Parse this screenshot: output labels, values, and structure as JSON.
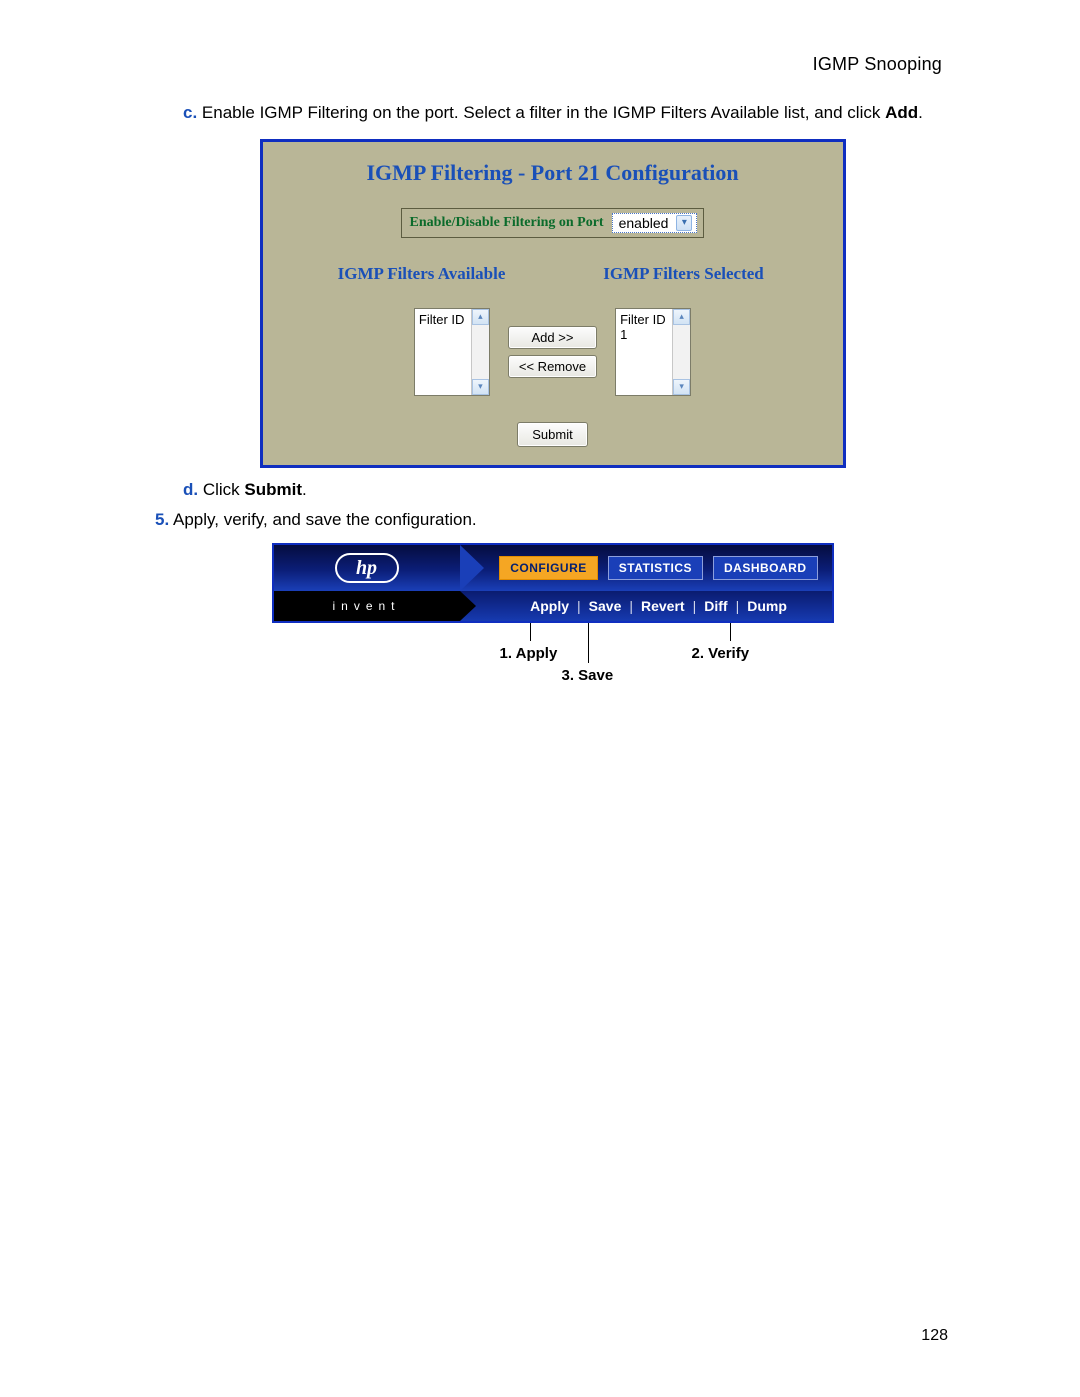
{
  "header": {
    "section_title": "IGMP Snooping"
  },
  "steps": {
    "c": {
      "marker": "c.",
      "text_before_bold": "Enable IGMP Filtering on the port. Select a filter in the IGMP Filters Available list, and click ",
      "bold": "Add",
      "after": "."
    },
    "d": {
      "marker": "d.",
      "text": "Click ",
      "bold": "Submit",
      "after": "."
    },
    "s5": {
      "marker": "5.",
      "text": "Apply, verify, and save the configuration."
    }
  },
  "panel1": {
    "title": "IGMP Filtering - Port 21 Configuration",
    "enable_label": "Enable/Disable Filtering on Port",
    "enable_value": "enabled",
    "available_header": "IGMP Filters Available",
    "selected_header": "IGMP Filters Selected",
    "available_col_label": "Filter ID",
    "selected_col_label": "Filter ID",
    "selected_items": [
      "1"
    ],
    "add_button": "Add >>",
    "remove_button": "<< Remove",
    "submit_button": "Submit"
  },
  "panel2": {
    "logo_text": "hp",
    "invent_text": "invent",
    "tabs": {
      "configure": "CONFIGURE",
      "statistics": "STATISTICS",
      "dashboard": "DASHBOARD"
    },
    "actions": {
      "apply": "Apply",
      "save": "Save",
      "revert": "Revert",
      "diff": "Diff",
      "dump": "Dump"
    },
    "annotations": {
      "apply": "1. Apply",
      "verify": "2. Verify",
      "save": "3. Save"
    }
  },
  "page_number": "128"
}
